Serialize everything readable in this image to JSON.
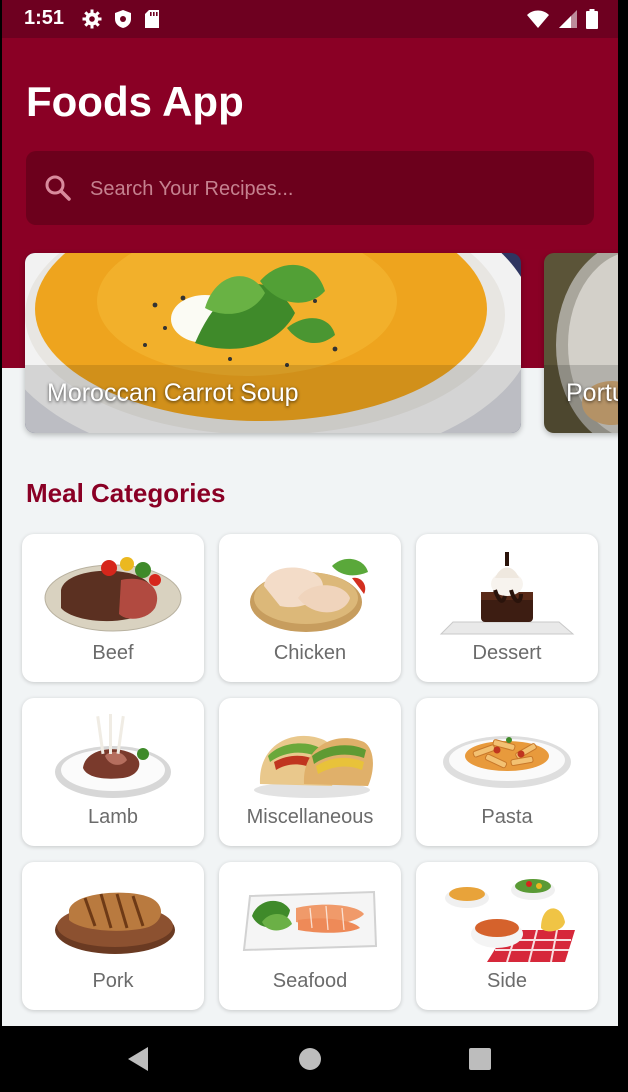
{
  "status_bar": {
    "time": "1:51"
  },
  "app": {
    "title": "Foods App"
  },
  "search": {
    "placeholder": "Search Your Recipes..."
  },
  "carousel": [
    {
      "label": "Moroccan Carrot Soup"
    },
    {
      "label": "Portu"
    }
  ],
  "categories_section": {
    "title": "Meal Categories"
  },
  "categories": [
    {
      "label": "Beef"
    },
    {
      "label": "Chicken"
    },
    {
      "label": "Dessert"
    },
    {
      "label": "Lamb"
    },
    {
      "label": "Miscellaneous"
    },
    {
      "label": "Pasta"
    },
    {
      "label": "Pork"
    },
    {
      "label": "Seafood"
    },
    {
      "label": "Side"
    }
  ],
  "colors": {
    "primary": "#8a0025",
    "primary_dark": "#6e0020",
    "search_bg": "#6c001c",
    "background": "#f1f4f5"
  },
  "icons": {
    "status_left": [
      "gear-icon",
      "shield-icon",
      "sd-card-icon"
    ],
    "status_right": [
      "wifi-icon",
      "signal-icon",
      "battery-icon"
    ],
    "nav": [
      "back-icon",
      "home-icon",
      "recents-icon"
    ]
  }
}
